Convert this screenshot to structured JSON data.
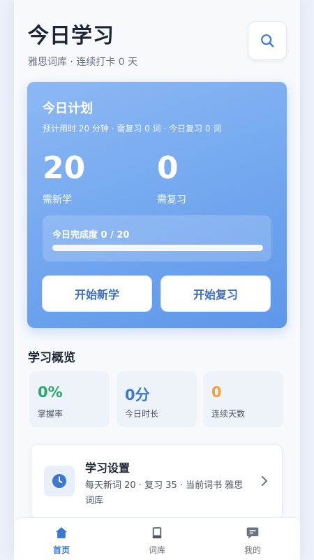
{
  "header": {
    "title": "今日学习",
    "subtitle": "雅思词库 · 连续打卡 0 天",
    "search_icon": "search-icon"
  },
  "plan": {
    "title": "今日计划",
    "subtitle": "预计用时 20 分钟 · 需复习 0 词 · 今日复习 0 词",
    "new_count": "20",
    "new_label": "需新学",
    "review_count": "0",
    "review_label": "需复习",
    "progress_label": "今日完成度 0 / 20",
    "progress_fraction": 0,
    "start_new_label": "开始新学",
    "start_review_label": "开始复习"
  },
  "overview": {
    "title": "学习概览",
    "stats": [
      {
        "value": "0%",
        "label": "掌握率",
        "color": "#2aa66b"
      },
      {
        "value": "0分",
        "label": "今日时长",
        "color": "#3b79d1"
      },
      {
        "value": "0",
        "label": "连续天数",
        "color": "#eea23a"
      }
    ]
  },
  "settings": {
    "title": "学习设置",
    "description": "每天新词 20 · 复习 35 · 当前词书 雅思词库",
    "icon": "clock-icon",
    "chevron_icon": "chevron-right-icon"
  },
  "tabs": [
    {
      "label": "首页",
      "icon": "home-icon",
      "active": true
    },
    {
      "label": "词库",
      "icon": "book-icon",
      "active": false
    },
    {
      "label": "我的",
      "icon": "message-icon",
      "active": false
    }
  ],
  "colors": {
    "accent": "#3b79d1",
    "tab_active": "#3b79d1",
    "tab_inactive": "#6b7280"
  }
}
